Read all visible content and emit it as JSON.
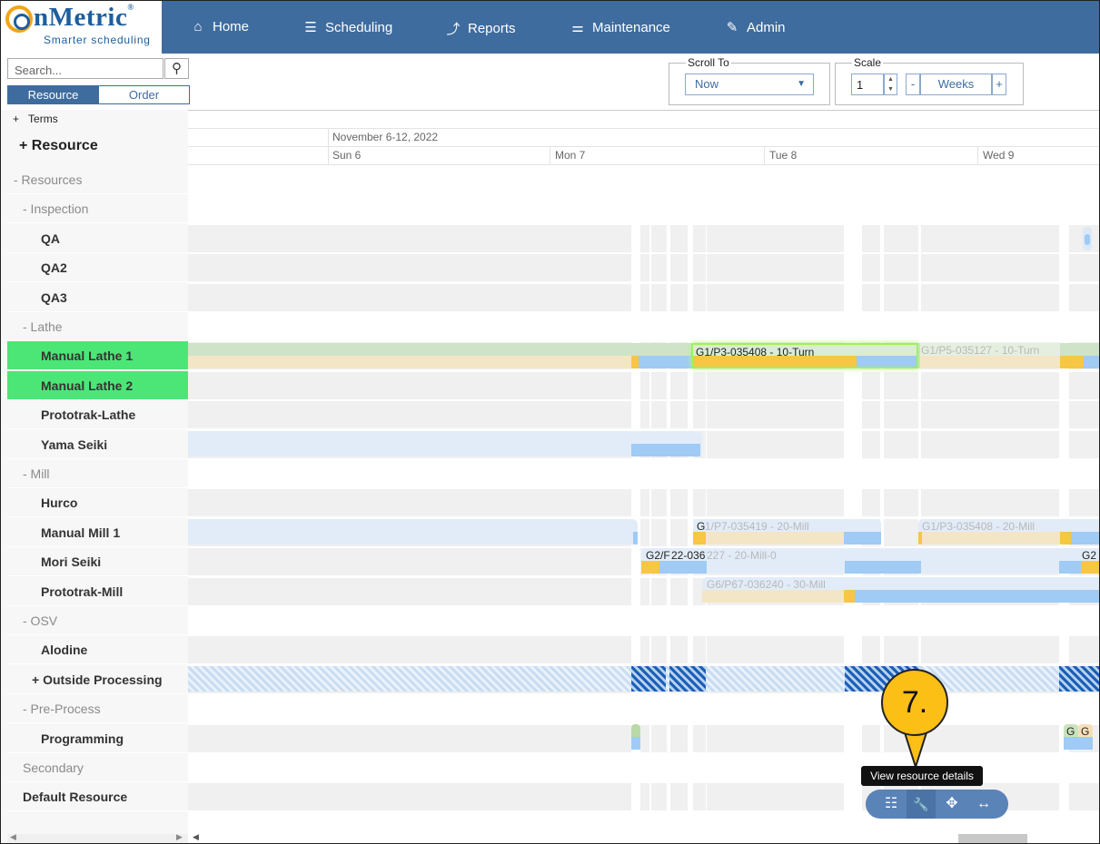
{
  "brand": {
    "name": "nMetric",
    "reg": "®",
    "tagline": "Smarter scheduling"
  },
  "nav": [
    {
      "label": "Home",
      "icon": "home-icon",
      "glyph": "⌂"
    },
    {
      "label": "Scheduling",
      "icon": "scheduling-icon",
      "glyph": "☰"
    },
    {
      "label": "Reports",
      "icon": "reports-chart-icon",
      "glyph": "⤴"
    },
    {
      "label": "Maintenance",
      "icon": "sliders-icon",
      "glyph": "⚌"
    },
    {
      "label": "Admin",
      "icon": "edit-icon",
      "glyph": "✎"
    }
  ],
  "search": {
    "placeholder": "Search...",
    "icon": "search-icon"
  },
  "tabs": {
    "resource": "Resource",
    "order": "Order"
  },
  "terms": {
    "prefix": "+",
    "label": "Terms"
  },
  "resource_header": "+ Resource",
  "rows": [
    {
      "label": "- Resources",
      "kind": "group",
      "indent": 0
    },
    {
      "label": "- Inspection",
      "kind": "group",
      "indent": 1
    },
    {
      "label": "QA",
      "kind": "leaf",
      "indent": 2
    },
    {
      "label": "QA2",
      "kind": "leaf",
      "indent": 2
    },
    {
      "label": "QA3",
      "kind": "leaf",
      "indent": 2
    },
    {
      "label": "- Lathe",
      "kind": "group",
      "indent": 1
    },
    {
      "label": "Manual Lathe 1",
      "kind": "leaf",
      "indent": 2,
      "selected": true
    },
    {
      "label": "Manual Lathe 2",
      "kind": "leaf",
      "indent": 2,
      "selected": true
    },
    {
      "label": "Prototrak-Lathe",
      "kind": "leaf",
      "indent": 2
    },
    {
      "label": "Yama Seiki",
      "kind": "leaf",
      "indent": 2
    },
    {
      "label": "- Mill",
      "kind": "group",
      "indent": 1
    },
    {
      "label": "Hurco",
      "kind": "leaf",
      "indent": 2
    },
    {
      "label": "Manual Mill 1",
      "kind": "leaf",
      "indent": 2
    },
    {
      "label": "Mori Seiki",
      "kind": "leaf",
      "indent": 2
    },
    {
      "label": "Prototrak-Mill",
      "kind": "leaf",
      "indent": 2
    },
    {
      "label": "- OSV",
      "kind": "group",
      "indent": 1
    },
    {
      "label": "Alodine",
      "kind": "leaf",
      "indent": 2
    },
    {
      "label": "+ Outside Processing",
      "kind": "leaf",
      "indent": 3
    },
    {
      "label": "- Pre-Process",
      "kind": "group",
      "indent": 1
    },
    {
      "label": "Programming",
      "kind": "leaf",
      "indent": 2
    },
    {
      "label": "Secondary",
      "kind": "group",
      "indent": 1
    },
    {
      "label": "Default Resource",
      "kind": "leaf",
      "indent": 1
    }
  ],
  "scroll_to": {
    "legend": "Scroll To",
    "value": "Now"
  },
  "scale": {
    "legend": "Scale",
    "value": "1",
    "minus": "-",
    "unit": "Weeks",
    "plus": "+"
  },
  "timeline": {
    "week_label": "November 6-12, 2022",
    "days": [
      "Sun 6",
      "Mon 7",
      "Tue 8",
      "Wed 9"
    ]
  },
  "jobs": {
    "lathe_active": "G1/P3-035408 - 10-Turn",
    "lathe_next": "G1/P5-035127 - 10-Turn",
    "mill_a_prefix": "G",
    "mill_a": "1/P7-035419 - 20-Mill",
    "mill_b": "G1/P3-035408 - 20-Mill",
    "mori_a": "G2/F",
    "mori_b": "22-036",
    "mori_c": "227 - 20-Mill-0",
    "mori_end": "G2",
    "prototrak": "G6/P67-036240 - 30-Mill",
    "prog_a": "G",
    "prog_b": "G"
  },
  "callout": {
    "number": "7.",
    "tooltip": "View resource details"
  },
  "floating_toolbar": [
    {
      "name": "list-details-icon",
      "glyph": "☷"
    },
    {
      "name": "wrench-icon",
      "glyph": "🔧"
    },
    {
      "name": "move-icon",
      "glyph": "✥"
    },
    {
      "name": "resize-horizontal-icon",
      "glyph": "↔"
    }
  ]
}
